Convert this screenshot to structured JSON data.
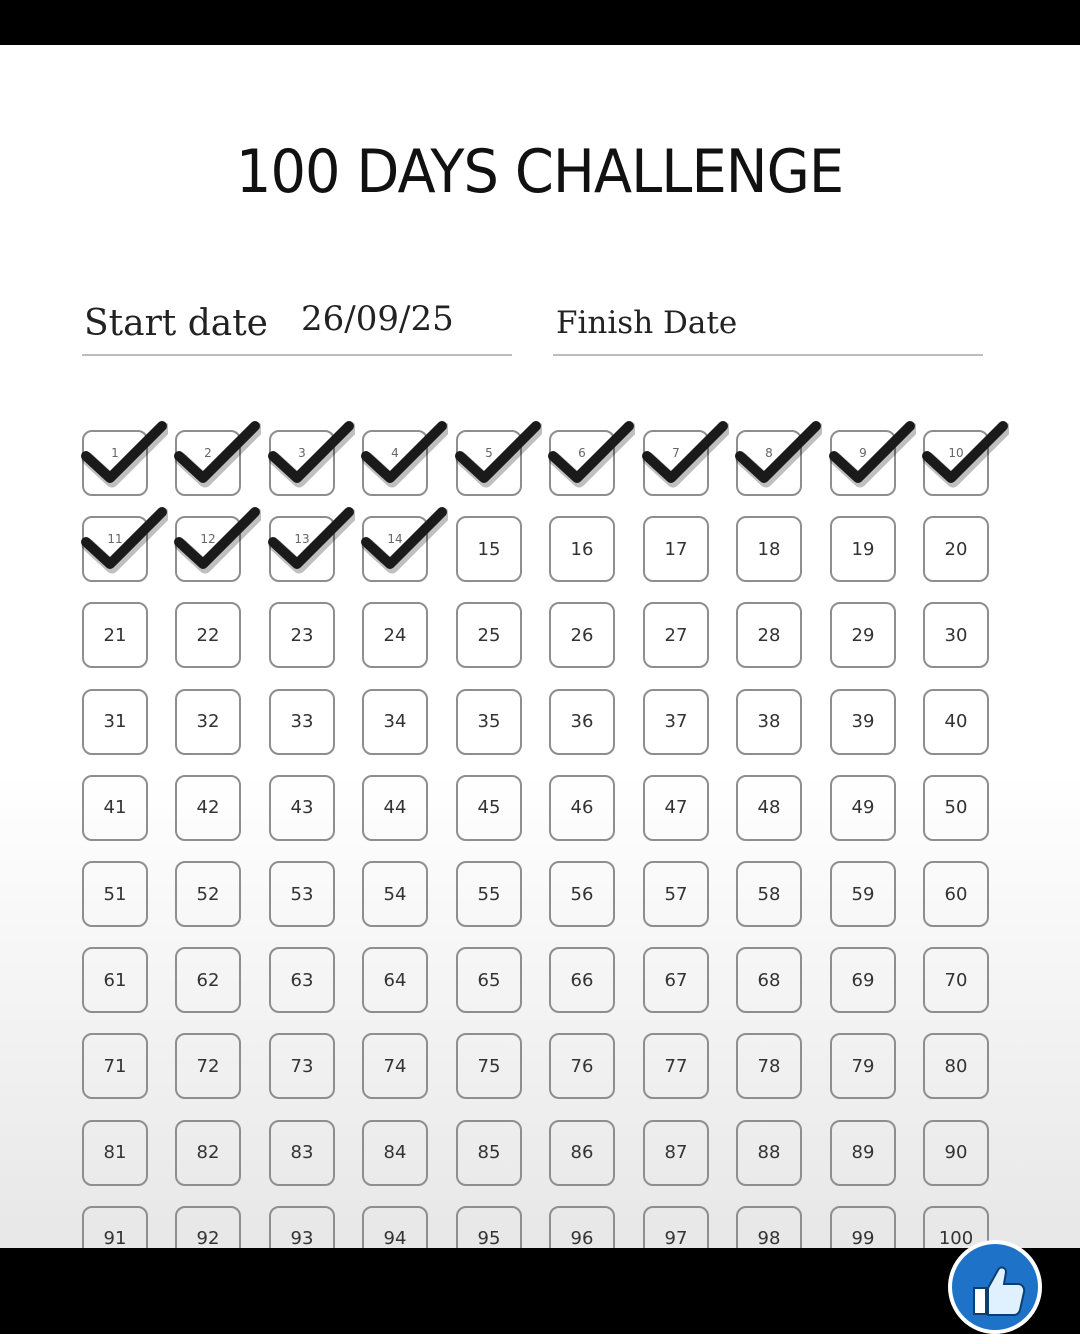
{
  "title": "100 DAYS CHALLENGE",
  "start": {
    "label": "Start date",
    "value": "26/09/25"
  },
  "finish": {
    "label": "Finish Date",
    "value": ""
  },
  "days_total": 100,
  "checked_days": [
    1,
    2,
    3,
    4,
    5,
    6,
    7,
    8,
    9,
    10,
    11,
    12,
    13,
    14
  ],
  "colors": {
    "check": "#1a1a1a",
    "box_border": "#8e8e8e",
    "like_button": "#1e73c9"
  },
  "icons": {
    "check": "check-mark-icon",
    "like": "thumbs-up-icon"
  }
}
